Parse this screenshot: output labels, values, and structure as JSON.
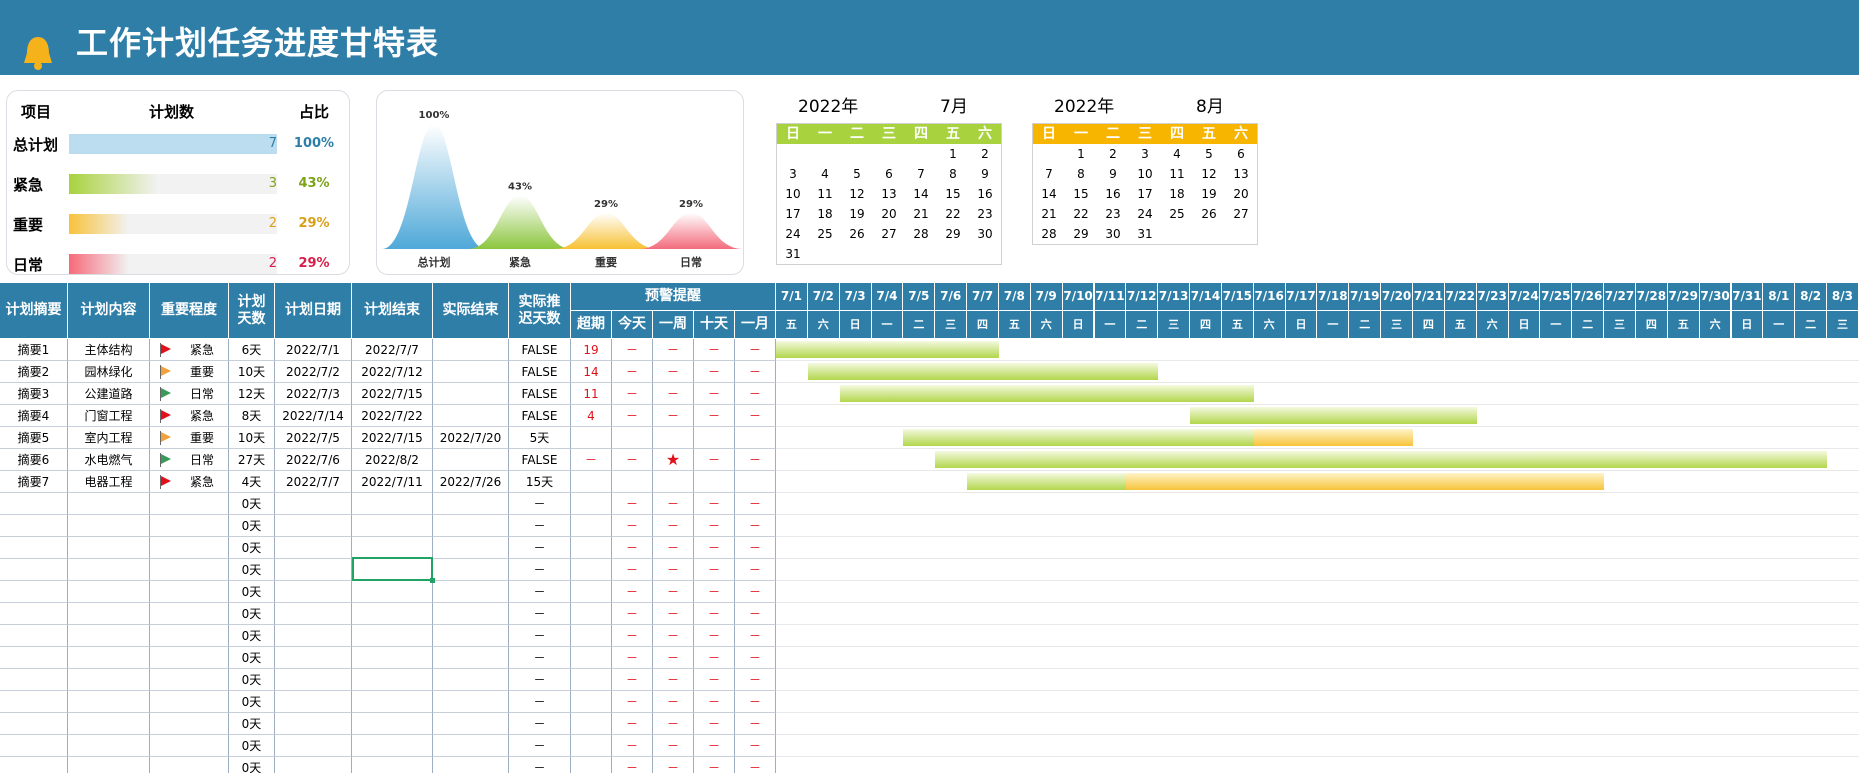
{
  "header": {
    "title": "工作计划任务进度甘特表",
    "bg_color": "#2e7ea8",
    "icon": "bell-icon"
  },
  "summary": {
    "col_item": "项目",
    "col_count": "计划数",
    "col_ratio": "占比",
    "rows": [
      {
        "label": "总计划",
        "count": "7",
        "ratio": "100%",
        "fill": 1.0,
        "color": "#bcdcef",
        "text_color": "#2e7ea8"
      },
      {
        "label": "紧急",
        "count": "3",
        "ratio": "43%",
        "fill": 0.43,
        "color": "#a9d23f",
        "text_color": "#7ea21a"
      },
      {
        "label": "重要",
        "count": "2",
        "ratio": "29%",
        "fill": 0.29,
        "color": "#f8c23a",
        "text_color": "#d8a01a"
      },
      {
        "label": "日常",
        "count": "2",
        "ratio": "29%",
        "fill": 0.29,
        "color": "#f66a7a",
        "text_color": "#d6204a"
      }
    ]
  },
  "chart_data": {
    "type": "area",
    "categories": [
      "总计划",
      "紧急",
      "重要",
      "日常"
    ],
    "values": [
      100,
      43,
      29,
      29
    ],
    "value_labels": [
      "100%",
      "43%",
      "29%",
      "29%"
    ],
    "colors": [
      "#4ea8d8",
      "#8cc63f",
      "#f7c133",
      "#f36b7c"
    ],
    "ylim": [
      0,
      100
    ]
  },
  "calendars": [
    {
      "year": "2022年",
      "month": "7月",
      "header_color": "#a9d23f",
      "weekdays": [
        "日",
        "一",
        "二",
        "三",
        "四",
        "五",
        "六"
      ],
      "weeks": [
        [
          "",
          "",
          "",
          "",
          "",
          "1",
          "2"
        ],
        [
          "3",
          "4",
          "5",
          "6",
          "7",
          "8",
          "9"
        ],
        [
          "10",
          "11",
          "12",
          "13",
          "14",
          "15",
          "16"
        ],
        [
          "17",
          "18",
          "19",
          "20",
          "21",
          "22",
          "23"
        ],
        [
          "24",
          "25",
          "26",
          "27",
          "28",
          "29",
          "30"
        ],
        [
          "31",
          "",
          "",
          "",
          "",
          "",
          ""
        ]
      ]
    },
    {
      "year": "2022年",
      "month": "8月",
      "header_color": "#f7b500",
      "weekdays": [
        "日",
        "一",
        "二",
        "三",
        "四",
        "五",
        "六"
      ],
      "weeks": [
        [
          "",
          "1",
          "2",
          "3",
          "4",
          "5",
          "6"
        ],
        [
          "7",
          "8",
          "9",
          "10",
          "11",
          "12",
          "13"
        ],
        [
          "14",
          "15",
          "16",
          "17",
          "18",
          "19",
          "20"
        ],
        [
          "21",
          "22",
          "23",
          "24",
          "25",
          "26",
          "27"
        ],
        [
          "28",
          "29",
          "30",
          "31",
          "",
          "",
          ""
        ]
      ]
    }
  ],
  "table": {
    "headers": [
      "计划摘要",
      "计划内容",
      "重要程度",
      "计划天数",
      "计划日期",
      "计划结束",
      "实际结束",
      "实际推迟天数"
    ],
    "warn_header": "预警提醒",
    "warn_cols": [
      "超期",
      "今天",
      "一周",
      "十天",
      "一月"
    ],
    "dates": [
      "7/1",
      "7/2",
      "7/3",
      "7/4",
      "7/5",
      "7/6",
      "7/7",
      "7/8",
      "7/9",
      "7/10",
      "7/11",
      "7/12",
      "7/13",
      "7/14",
      "7/15",
      "7/16",
      "7/17",
      "7/18",
      "7/19",
      "7/20",
      "7/21",
      "7/22",
      "7/23",
      "7/24",
      "7/25",
      "7/26",
      "7/27",
      "7/28",
      "7/29",
      "7/30",
      "7/31",
      "8/1",
      "8/2",
      "8/3"
    ],
    "weekdays": [
      "五",
      "六",
      "日",
      "一",
      "二",
      "三",
      "四",
      "五",
      "六",
      "日",
      "一",
      "二",
      "三",
      "四",
      "五",
      "六",
      "日",
      "一",
      "二",
      "三",
      "四",
      "五",
      "六",
      "日",
      "一",
      "二",
      "三",
      "四",
      "五",
      "六",
      "日",
      "一",
      "二",
      "三"
    ],
    "rows": [
      {
        "summary": "摘要1",
        "content": "主体结构",
        "flag": "#e0111b",
        "level": "紧急",
        "days": "6天",
        "start": "2022/7/1",
        "end": "2022/7/7",
        "actual": "",
        "delay": "FALSE",
        "warn": [
          "19",
          "－",
          "－",
          "－",
          "－"
        ],
        "plan": [
          1,
          7
        ],
        "over": null
      },
      {
        "summary": "摘要2",
        "content": "园林绿化",
        "flag": "#f2a23c",
        "level": "重要",
        "days": "10天",
        "start": "2022/7/2",
        "end": "2022/7/12",
        "actual": "",
        "delay": "FALSE",
        "warn": [
          "14",
          "－",
          "－",
          "－",
          "－"
        ],
        "plan": [
          2,
          12
        ],
        "over": null
      },
      {
        "summary": "摘要3",
        "content": "公建道路",
        "flag": "#3a9a5a",
        "level": "日常",
        "days": "12天",
        "start": "2022/7/3",
        "end": "2022/7/15",
        "actual": "",
        "delay": "FALSE",
        "warn": [
          "11",
          "－",
          "－",
          "－",
          "－"
        ],
        "plan": [
          3,
          15
        ],
        "over": null
      },
      {
        "summary": "摘要4",
        "content": "门窗工程",
        "flag": "#e0111b",
        "level": "紧急",
        "days": "8天",
        "start": "2022/7/14",
        "end": "2022/7/22",
        "actual": "",
        "delay": "FALSE",
        "warn": [
          "4",
          "－",
          "－",
          "－",
          "－"
        ],
        "plan": [
          14,
          22
        ],
        "over": null
      },
      {
        "summary": "摘要5",
        "content": "室内工程",
        "flag": "#f2a23c",
        "level": "重要",
        "days": "10天",
        "start": "2022/7/5",
        "end": "2022/7/15",
        "actual": "2022/7/20",
        "delay": "5天",
        "warn": [
          "",
          "",
          "",
          "",
          ""
        ],
        "plan": [
          5,
          15
        ],
        "over": [
          16,
          20
        ]
      },
      {
        "summary": "摘要6",
        "content": "水电燃气",
        "flag": "#3a9a5a",
        "level": "日常",
        "days": "27天",
        "start": "2022/7/6",
        "end": "2022/8/2",
        "actual": "",
        "delay": "FALSE",
        "warn": [
          "－",
          "－",
          "★",
          "－",
          "－"
        ],
        "plan": [
          6,
          33
        ],
        "over": null
      },
      {
        "summary": "摘要7",
        "content": "电器工程",
        "flag": "#e0111b",
        "level": "紧急",
        "days": "4天",
        "start": "2022/7/7",
        "end": "2022/7/11",
        "actual": "2022/7/26",
        "delay": "15天",
        "warn": [
          "",
          "",
          "",
          "",
          ""
        ],
        "plan": [
          7,
          11
        ],
        "over": [
          12,
          26
        ]
      }
    ],
    "empty_days": "0天",
    "empty_delay": "－",
    "dash": "－"
  }
}
